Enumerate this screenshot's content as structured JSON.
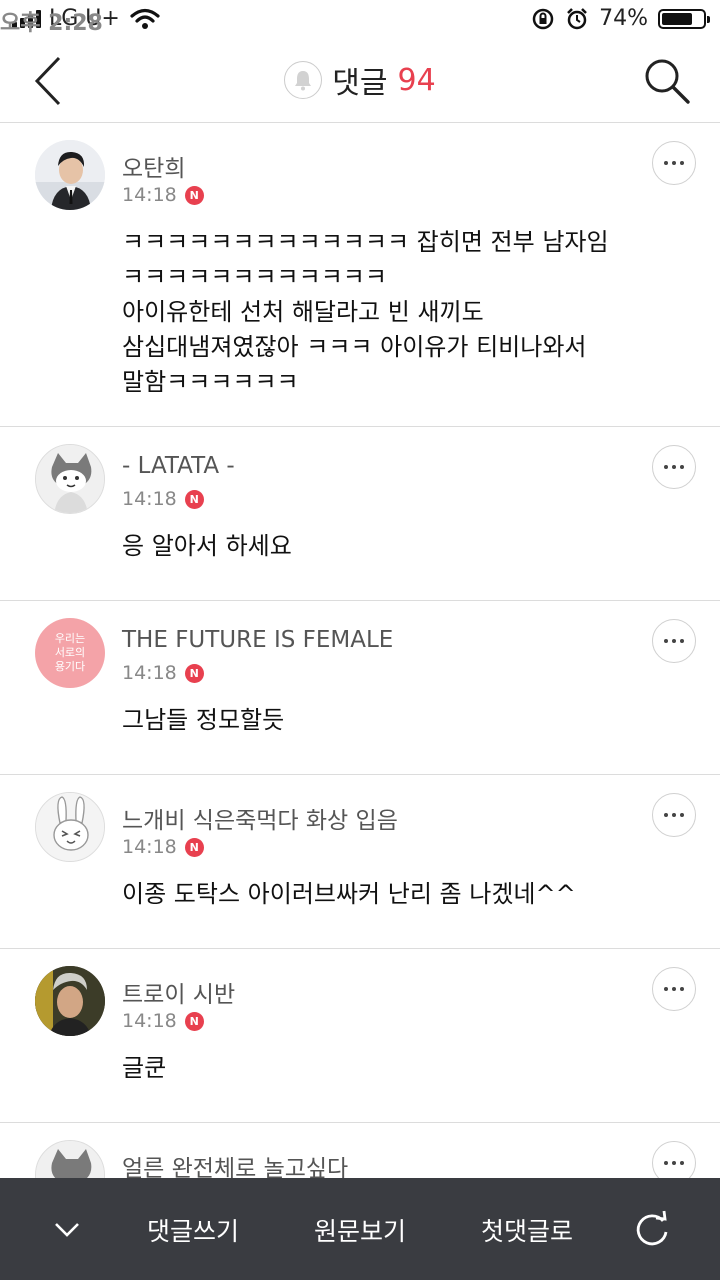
{
  "status": {
    "carrier": "LG U+",
    "time": "오후 2:28",
    "battery": "74%",
    "battery_level": 0.74
  },
  "header": {
    "title": "댓글",
    "count": "94"
  },
  "comments": [
    {
      "name": "오탄희",
      "time": "14:18",
      "badge": "N",
      "text": "ㅋㅋㅋㅋㅋㅋㅋㅋㅋㅋㅋㅋㅋ 잡히면 전부 남자임\nㅋㅋㅋㅋㅋㅋㅋㅋㅋㅋㅋㅋ\n아이유한테 선처 해달라고 빈 새끼도\n삼십대냄져였잖아 ㅋㅋㅋ 아이유가 티비나와서\n말함ㅋㅋㅋㅋㅋㅋ"
    },
    {
      "name": "- LATATA -",
      "time": "14:18",
      "badge": "N",
      "text": "응 알아서 하세요"
    },
    {
      "name": "THE FUTURE IS FEMALE",
      "time": "14:18",
      "badge": "N",
      "text": "그남들 정모할듯",
      "avatar_text": "우리는\n서로의\n용기다"
    },
    {
      "name": "느개비 식은죽먹다 화상 입음",
      "time": "14:18",
      "badge": "N",
      "text": "이종 도탁스 아이러브싸커 난리 좀 나겠네^^"
    },
    {
      "name": "트로이 시반",
      "time": "14:18",
      "badge": "N",
      "text": "글쿤"
    },
    {
      "name": "얼른 완전체로 놀고싶다",
      "time": "",
      "badge": "",
      "text": ""
    }
  ],
  "bottom": {
    "write": "댓글쓰기",
    "original": "원문보기",
    "first": "첫댓글로"
  },
  "colors": {
    "accent": "#e8404f",
    "bottom_bar": "#3a3c41",
    "pink_avatar": "#f4a3a8"
  }
}
